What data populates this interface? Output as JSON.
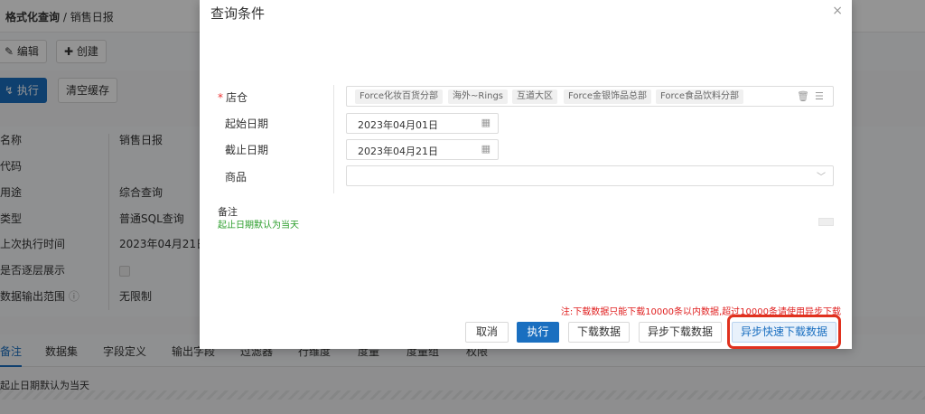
{
  "background": {
    "breadcrumb": {
      "root": "格式化查询",
      "sep": " / ",
      "current": "销售日报"
    },
    "toolbar": {
      "edit": "编辑",
      "create": "创建",
      "execute": "执行",
      "clear_cache": "清空缓存"
    },
    "fields": [
      {
        "label": "名称",
        "value": "销售日报"
      },
      {
        "label": "代码",
        "value": ""
      },
      {
        "label": "用途",
        "value": "综合查询"
      },
      {
        "label": "类型",
        "value": "普通SQL查询"
      },
      {
        "label": "上次执行时间",
        "value": "2023年04月21日"
      },
      {
        "label": "是否逐层展示",
        "value": ""
      },
      {
        "label": "数据输出范围",
        "value": "无限制"
      }
    ],
    "tabs": [
      "备注",
      "数据集",
      "字段定义",
      "输出字段",
      "过滤器",
      "行维度",
      "度量",
      "度量组",
      "权限"
    ],
    "note": "起止日期默认为当天"
  },
  "modal": {
    "title": "查询条件",
    "close": "×",
    "store_label": "店仓",
    "store_required": "*",
    "store_tags": [
      "Force化妆百货分部",
      "海外~Rings",
      "互道大区",
      "Force金银饰品总部",
      "Force食品饮料分部"
    ],
    "start_label": "起始日期",
    "start_value": "2023年04月01日",
    "end_label": "截止日期",
    "end_value": "2023年04月21日",
    "product_label": "商品",
    "remark_label": "备注",
    "remark_text": "起止日期默认为当天",
    "warning": "注:下载数据只能下载10000条以内数据,超过10000条请使用异步下载",
    "buttons": {
      "cancel": "取消",
      "execute": "执行",
      "download": "下载数据",
      "async_download": "异步下载数据",
      "async_fast_download": "异步快速下载数据"
    },
    "colors": {
      "primary": "#1a6fc0",
      "warning": "#e02020",
      "remark": "#2a9d2a",
      "highlight": "#e0311e"
    }
  }
}
